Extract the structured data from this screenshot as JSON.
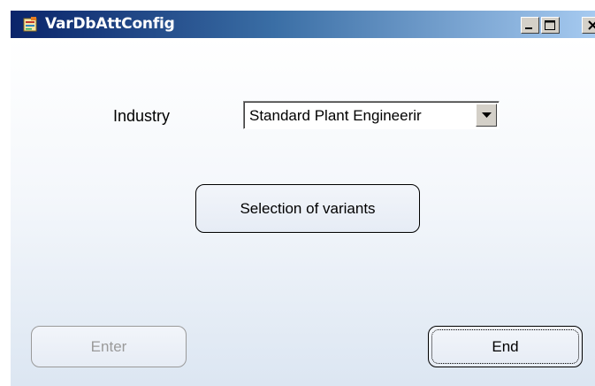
{
  "window": {
    "title": "VarDbAttConfig"
  },
  "form": {
    "industry_label": "Industry",
    "industry_value": "Standard Plant Engineerir"
  },
  "buttons": {
    "variants_label": "Selection of variants",
    "enter_label": "Enter",
    "end_label": "End"
  },
  "icons": {
    "app": "app-icon",
    "minimize": "minimize-icon",
    "maximize": "maximize-icon",
    "close": "close-icon",
    "dropdown": "chevron-down-icon"
  }
}
